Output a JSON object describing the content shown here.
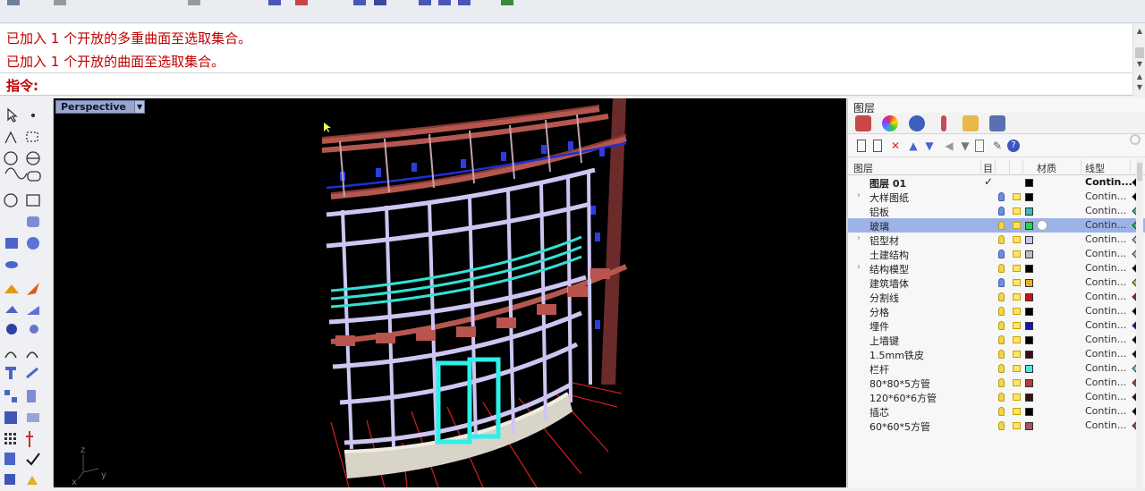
{
  "command": {
    "history": [
      "已加入 1 个开放的多重曲面至选取集合。",
      "已加入 1 个开放的曲面至选取集合。"
    ],
    "prompt": "指令:"
  },
  "viewport": {
    "name": "Perspective",
    "axis_labels": {
      "z": "z",
      "x": "x",
      "y": "y"
    }
  },
  "layers_panel": {
    "title": "图层",
    "columns": {
      "name": "图层",
      "current": "目",
      "material": "材质",
      "linetype": "线型"
    },
    "layers": [
      {
        "name": "图层 01",
        "current": true,
        "color": "#000000",
        "linetype": "Contin...",
        "bold": true,
        "expandable": false,
        "bulb": "blue",
        "lock": false,
        "selected": false,
        "print_color": "#000000"
      },
      {
        "name": "大样图纸",
        "current": false,
        "color": "#000000",
        "linetype": "Contin...",
        "bold": false,
        "expandable": true,
        "bulb": "blue",
        "lock": true,
        "selected": false,
        "print_color": "#000000"
      },
      {
        "name": "铝板",
        "current": false,
        "color": "#44b7b7",
        "linetype": "Contin...",
        "bold": false,
        "expandable": false,
        "bulb": "blue",
        "lock": true,
        "selected": false,
        "print_color": "#44b7b7"
      },
      {
        "name": "玻璃",
        "current": false,
        "color": "#2ad14b",
        "linetype": "Contin...",
        "bold": false,
        "expandable": false,
        "bulb": "yellow",
        "lock": true,
        "selected": true,
        "print_color": "#2ad14b"
      },
      {
        "name": "铝型材",
        "current": false,
        "color": "#c9c4ee",
        "linetype": "Contin...",
        "bold": false,
        "expandable": true,
        "bulb": "yellow",
        "lock": true,
        "selected": false,
        "print_color": "#c9c4ee"
      },
      {
        "name": "土建结构",
        "current": false,
        "color": "#bdbdbd",
        "linetype": "Contin...",
        "bold": false,
        "expandable": false,
        "bulb": "blue",
        "lock": true,
        "selected": false,
        "print_color": "#bdbdbd"
      },
      {
        "name": "结构模型",
        "current": false,
        "color": "#000000",
        "linetype": "Contin...",
        "bold": false,
        "expandable": true,
        "bulb": "yellow",
        "lock": true,
        "selected": false,
        "print_color": "#000000"
      },
      {
        "name": "建筑墙体",
        "current": false,
        "color": "#e3b12a",
        "linetype": "Contin...",
        "bold": false,
        "expandable": false,
        "bulb": "blue",
        "lock": true,
        "selected": false,
        "print_color": "#e3b12a"
      },
      {
        "name": "分割线",
        "current": false,
        "color": "#c81414",
        "linetype": "Contin...",
        "bold": false,
        "expandable": false,
        "bulb": "yellow",
        "lock": true,
        "selected": false,
        "print_color": "#c81414"
      },
      {
        "name": "分格",
        "current": false,
        "color": "#000000",
        "linetype": "Contin...",
        "bold": false,
        "expandable": false,
        "bulb": "yellow",
        "lock": true,
        "selected": false,
        "print_color": "#000000"
      },
      {
        "name": "埋件",
        "current": false,
        "color": "#1515b8",
        "linetype": "Contin...",
        "bold": false,
        "expandable": false,
        "bulb": "yellow",
        "lock": true,
        "selected": false,
        "print_color": "#1515b8"
      },
      {
        "name": "上墙键",
        "current": false,
        "color": "#000000",
        "linetype": "Contin...",
        "bold": false,
        "expandable": false,
        "bulb": "yellow",
        "lock": true,
        "selected": false,
        "print_color": "#000000"
      },
      {
        "name": "1.5mm铁皮",
        "current": false,
        "color": "#3a0d17",
        "linetype": "Contin...",
        "bold": false,
        "expandable": false,
        "bulb": "yellow",
        "lock": true,
        "selected": false,
        "print_color": "#3a0d17"
      },
      {
        "name": "栏杆",
        "current": false,
        "color": "#4be6e6",
        "linetype": "Contin...",
        "bold": false,
        "expandable": false,
        "bulb": "yellow",
        "lock": true,
        "selected": false,
        "print_color": "#4be6e6"
      },
      {
        "name": "80*80*5方管",
        "current": false,
        "color": "#b5393f",
        "linetype": "Contin...",
        "bold": false,
        "expandable": false,
        "bulb": "yellow",
        "lock": true,
        "selected": false,
        "print_color": "#b5393f"
      },
      {
        "name": "120*60*6方管",
        "current": false,
        "color": "#3b1212",
        "linetype": "Contin...",
        "bold": false,
        "expandable": false,
        "bulb": "yellow",
        "lock": true,
        "selected": false,
        "print_color": "#3b1212"
      },
      {
        "name": "插芯",
        "current": false,
        "color": "#000000",
        "linetype": "Contin...",
        "bold": false,
        "expandable": false,
        "bulb": "yellow",
        "lock": true,
        "selected": false,
        "print_color": "#000000"
      },
      {
        "name": "60*60*5方管",
        "current": false,
        "color": "#b04e5c",
        "linetype": "Contin...",
        "bold": false,
        "expandable": false,
        "bulb": "yellow",
        "lock": true,
        "selected": false,
        "print_color": "#b04e5c"
      }
    ]
  }
}
